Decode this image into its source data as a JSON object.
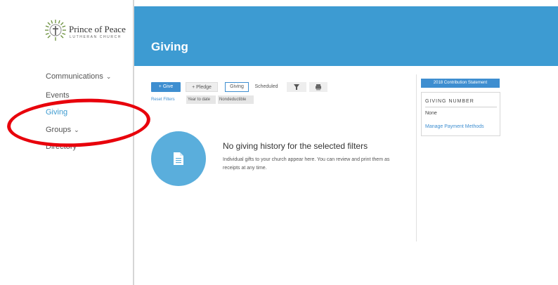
{
  "brand": {
    "title": "Prince of Peace",
    "subtitle": "LUTHERAN CHURCH",
    "icon": "cross-sunburst-logo",
    "accent": "#3e9bd0"
  },
  "sidebar": {
    "items": [
      {
        "label": "Communications",
        "has_chevron": true
      },
      {
        "label": "Events",
        "has_chevron": false
      },
      {
        "label": "Giving",
        "has_chevron": false,
        "active": true
      },
      {
        "label": "Groups",
        "has_chevron": true
      },
      {
        "label": "Directory",
        "has_chevron": false
      }
    ]
  },
  "header": {
    "title": "Giving",
    "background": "#3d9bd2"
  },
  "toolbar": {
    "give_label": "+ Give",
    "pledge_label": "+ Pledge",
    "tab_giving": "Giving",
    "tab_scheduled": "Scheduled",
    "filter_icon": "filter-icon",
    "print_icon": "print-icon"
  },
  "filters": {
    "reset": "Reset Filters",
    "chips": [
      "Year to date",
      "Nondeductible"
    ]
  },
  "empty_state": {
    "icon": "document-icon",
    "title": "No giving history for the selected filters",
    "text": "Individual gifts to your church appear here. You can review and print them as receipts at any time."
  },
  "right_panel": {
    "statement_button": "2018 Contribution Statement",
    "giving_number_heading": "GIVING NUMBER",
    "giving_number_value": "None",
    "manage_link": "Manage Payment Methods"
  },
  "annotation": {
    "color": "#e8000b"
  }
}
